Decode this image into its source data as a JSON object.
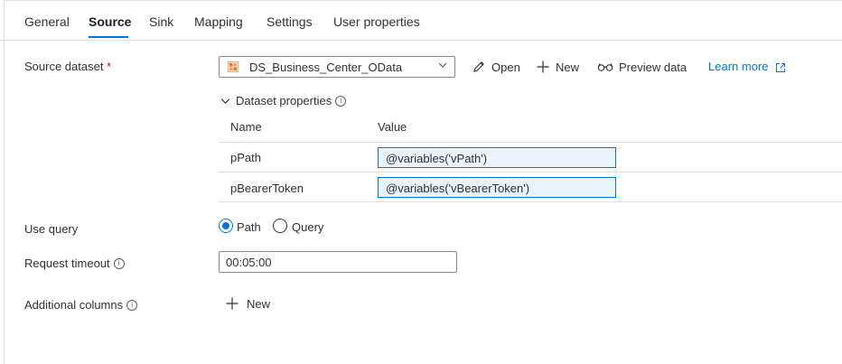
{
  "tabs": [
    "General",
    "Source",
    "Sink",
    "Mapping",
    "Settings",
    "User properties"
  ],
  "source_dataset": {
    "label": "Source dataset",
    "required_marker": "*",
    "value": "DS_Business_Center_OData",
    "actions": {
      "open": "Open",
      "new": "New",
      "preview": "Preview data",
      "learn_more": "Learn more"
    }
  },
  "dataset_properties": {
    "header": "Dataset properties",
    "columns": {
      "name": "Name",
      "value": "Value"
    },
    "rows": [
      {
        "name": "pPath",
        "value": "@variables('vPath')"
      },
      {
        "name": "pBearerToken",
        "value": "@variables('vBearerToken')"
      }
    ]
  },
  "use_query": {
    "label": "Use query",
    "options": [
      "Path",
      "Query"
    ],
    "selected": "Path"
  },
  "request_timeout": {
    "label": "Request timeout",
    "value": "00:05:00"
  },
  "additional_columns": {
    "label": "Additional columns",
    "new_label": "New"
  },
  "colors": {
    "accent": "#0078d4",
    "required": "#a4262c",
    "input_fill": "#e8f3fc"
  }
}
